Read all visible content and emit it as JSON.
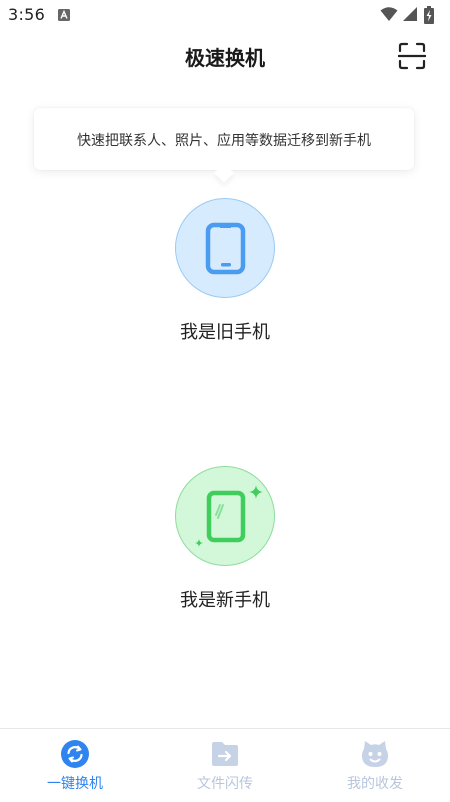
{
  "status_bar": {
    "time": "3:56"
  },
  "header": {
    "title": "极速换机",
    "scan_icon": "scan-icon"
  },
  "tip": {
    "text": "快速把联系人、照片、应用等数据迁移到新手机"
  },
  "options": {
    "old_phone_label": "我是旧手机",
    "new_phone_label": "我是新手机"
  },
  "bottom_nav": {
    "items": [
      {
        "label": "一键换机",
        "icon": "switch-phone-icon",
        "active": true
      },
      {
        "label": "文件闪传",
        "icon": "file-transfer-icon",
        "active": false
      },
      {
        "label": "我的收发",
        "icon": "my-transfers-icon",
        "active": false
      }
    ]
  },
  "colors": {
    "accent": "#2f84f0",
    "inactive": "#b8c6dd",
    "old_phone_bg": "#d6ebfd",
    "old_phone_icon": "#4a9cf0",
    "new_phone_bg": "#d3f7d9",
    "new_phone_icon": "#3fce5c"
  }
}
